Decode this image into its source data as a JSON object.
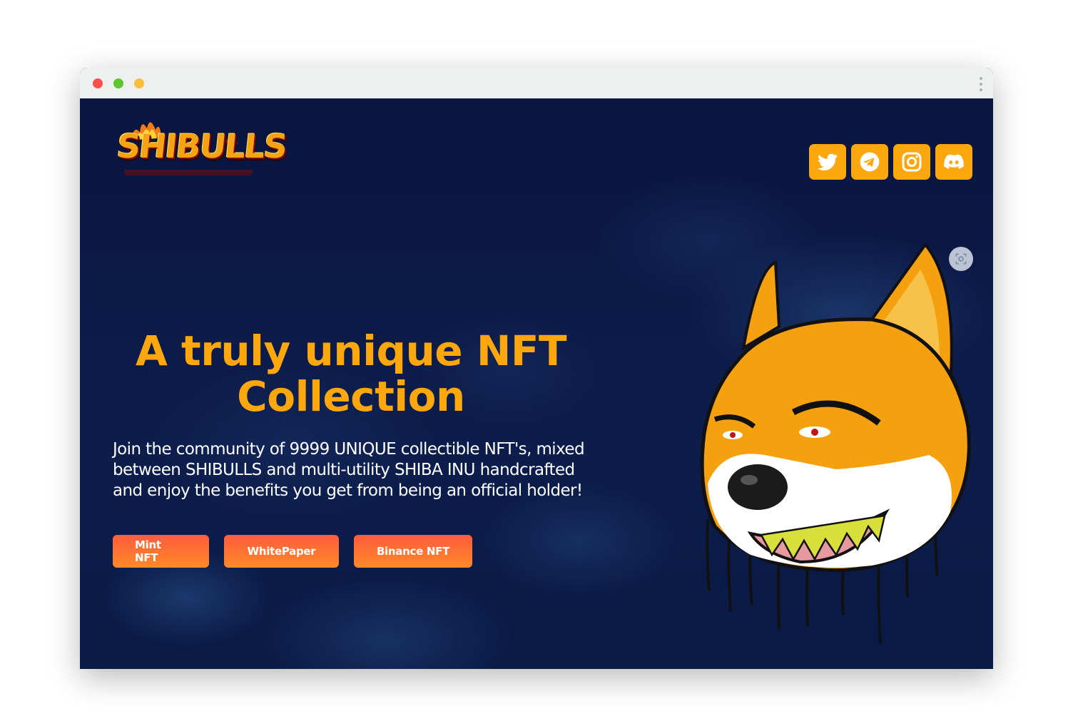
{
  "brand": {
    "logo_text": "SHIBULLS"
  },
  "social": [
    {
      "name": "twitter-icon"
    },
    {
      "name": "telegram-icon"
    },
    {
      "name": "instagram-icon"
    },
    {
      "name": "discord-icon"
    }
  ],
  "hero": {
    "headline": "A truly unique NFT Collection",
    "description": "Join the community of 9999 UNIQUE collectible NFT's, mixed between SHIBULLS and multi-utility SHIBA INU handcrafted and enjoy the benefits you get from being an official holder!",
    "buttons": {
      "mint": "Mint NFT",
      "whitepaper": "WhitePaper",
      "binance": "Binance NFT"
    }
  },
  "colors": {
    "accent": "#fba70d",
    "background": "#0b1a45",
    "button_start": "#fd5b3e",
    "button_end": "#ff8a27"
  }
}
